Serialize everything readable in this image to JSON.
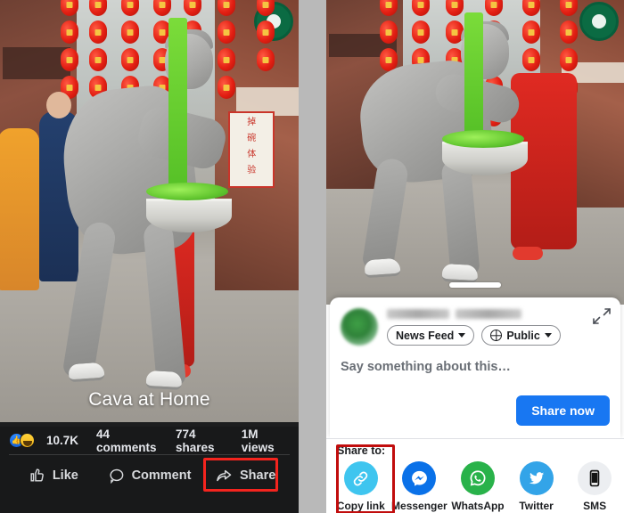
{
  "left_post": {
    "video_caption": "Cava at Home",
    "stats": {
      "reaction_count": "10.7K",
      "comments": "44 comments",
      "shares": "774 shares",
      "views": "1M views",
      "reaction_icons": [
        "like-thumbs-up-icon",
        "haha-laughing-icon"
      ]
    },
    "actions": [
      {
        "label": "Like",
        "icon": "thumbs-up-icon"
      },
      {
        "label": "Comment",
        "icon": "comment-bubble-icon"
      },
      {
        "label": "Share",
        "icon": "share-arrow-icon"
      }
    ],
    "highlight_color": "#f4241e"
  },
  "right_panel": {
    "share_dialog": {
      "author_name": "",
      "audience_dropdown": {
        "label": "News Feed",
        "icon": "chevron-down-icon"
      },
      "privacy_dropdown": {
        "label": "Public",
        "icon": "globe-icon",
        "caret": "chevron-down-icon"
      },
      "composer_placeholder": "Say something about this…",
      "primary_button": "Share now",
      "expand_icon": "expand-diagonal-icon",
      "primary_button_color": "#1877f2"
    },
    "share_to": {
      "label": "Share to:",
      "targets": [
        {
          "label": "Copy link",
          "icon": "link-chain-icon",
          "color": "#3fc5ef"
        },
        {
          "label": "Messenger",
          "icon": "messenger-bolt-icon",
          "color": "#0a71e8"
        },
        {
          "label": "WhatsApp",
          "icon": "whatsapp-phone-icon",
          "color": "#29b24a"
        },
        {
          "label": "Twitter",
          "icon": "twitter-bird-icon",
          "color": "#33a4e8"
        },
        {
          "label": "SMS",
          "icon": "mobile-phone-icon",
          "color": "#eceef1"
        }
      ],
      "highlight_target": "Copy link",
      "highlight_color": "#c10d0d"
    }
  }
}
